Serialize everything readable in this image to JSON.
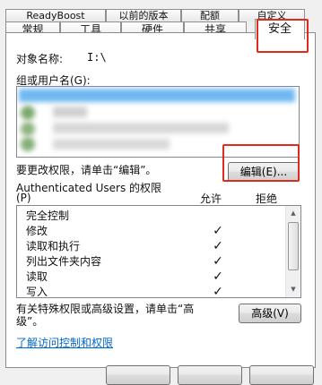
{
  "tabs": {
    "back_row": [
      "ReadyBoost",
      "以前的版本",
      "配额",
      "自定义"
    ],
    "front_row": [
      "常规",
      "工具",
      "硬件",
      "共享",
      "安全"
    ]
  },
  "object_name": {
    "label": "对象名称:",
    "value": "I:\\"
  },
  "groups": {
    "label": "组或用户名(G):"
  },
  "change_permissions": {
    "text": "要更改权限，请单击“编辑”。",
    "edit_button": "编辑(E)..."
  },
  "permissions": {
    "title": "Authenticated Users 的权限",
    "title_line2": "(P)",
    "allow_header": "允许",
    "deny_header": "拒绝",
    "rows": [
      {
        "name": "完全控制",
        "allow": ""
      },
      {
        "name": "修改",
        "allow": "✓"
      },
      {
        "name": "读取和执行",
        "allow": "✓"
      },
      {
        "name": "列出文件夹内容",
        "allow": "✓"
      },
      {
        "name": "读取",
        "allow": "✓"
      },
      {
        "name": "写入",
        "allow": "✓"
      }
    ]
  },
  "advanced": {
    "text_line1": "有关特殊权限或高级设置，请单击“高",
    "text_line2": "级”。",
    "button": "高级(V)"
  },
  "learn_link": "了解访问控制和权限",
  "colors": {
    "highlight_red": "#e0291f",
    "link_blue": "#0066cc"
  }
}
